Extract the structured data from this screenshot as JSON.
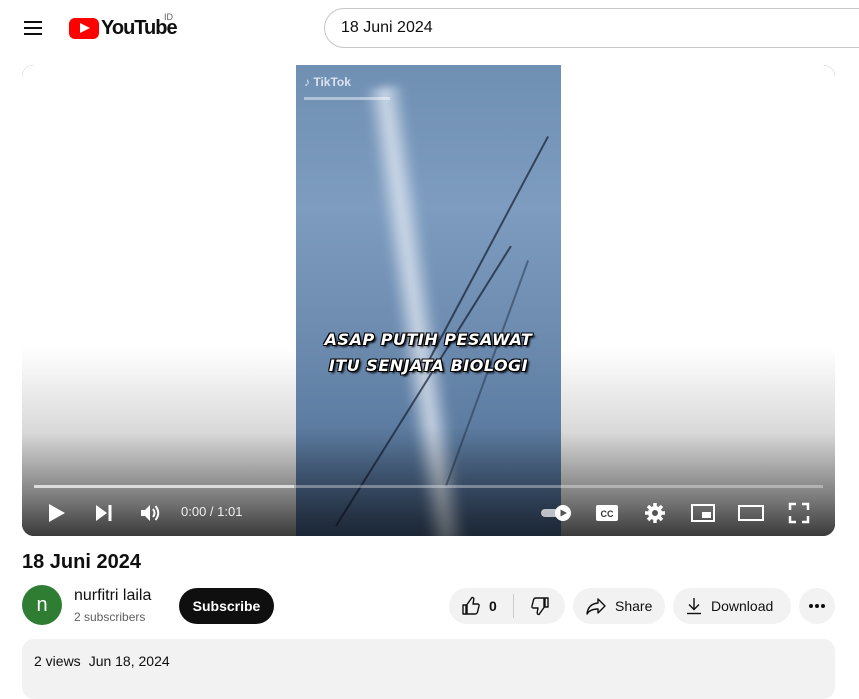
{
  "header": {
    "logo_text": "YouTube",
    "country_code": "ID",
    "search_value": "18 Juni 2024"
  },
  "video": {
    "tiktok_watermark": "TikTok",
    "caption_line1": "ASAP PUTIH PESAWAT",
    "caption_line2": "ITU SENJATA BIOLOGI",
    "progress_loaded_fraction": 0.33,
    "time_display": "0:00 / 1:01",
    "autoplay": "on"
  },
  "info": {
    "title": "18 Juni 2024",
    "channel_name": "nurfitri laila",
    "channel_initial": "n",
    "subscribers": "2 subscribers",
    "subscribe_label": "Subscribe",
    "like_count": "0",
    "share_label": "Share",
    "download_label": "Download",
    "views": "2 views",
    "date": "Jun 18, 2024"
  },
  "colors": {
    "brand_red": "#ff0000",
    "avatar": "#2e7d32",
    "pill_bg": "#f2f2f2"
  }
}
